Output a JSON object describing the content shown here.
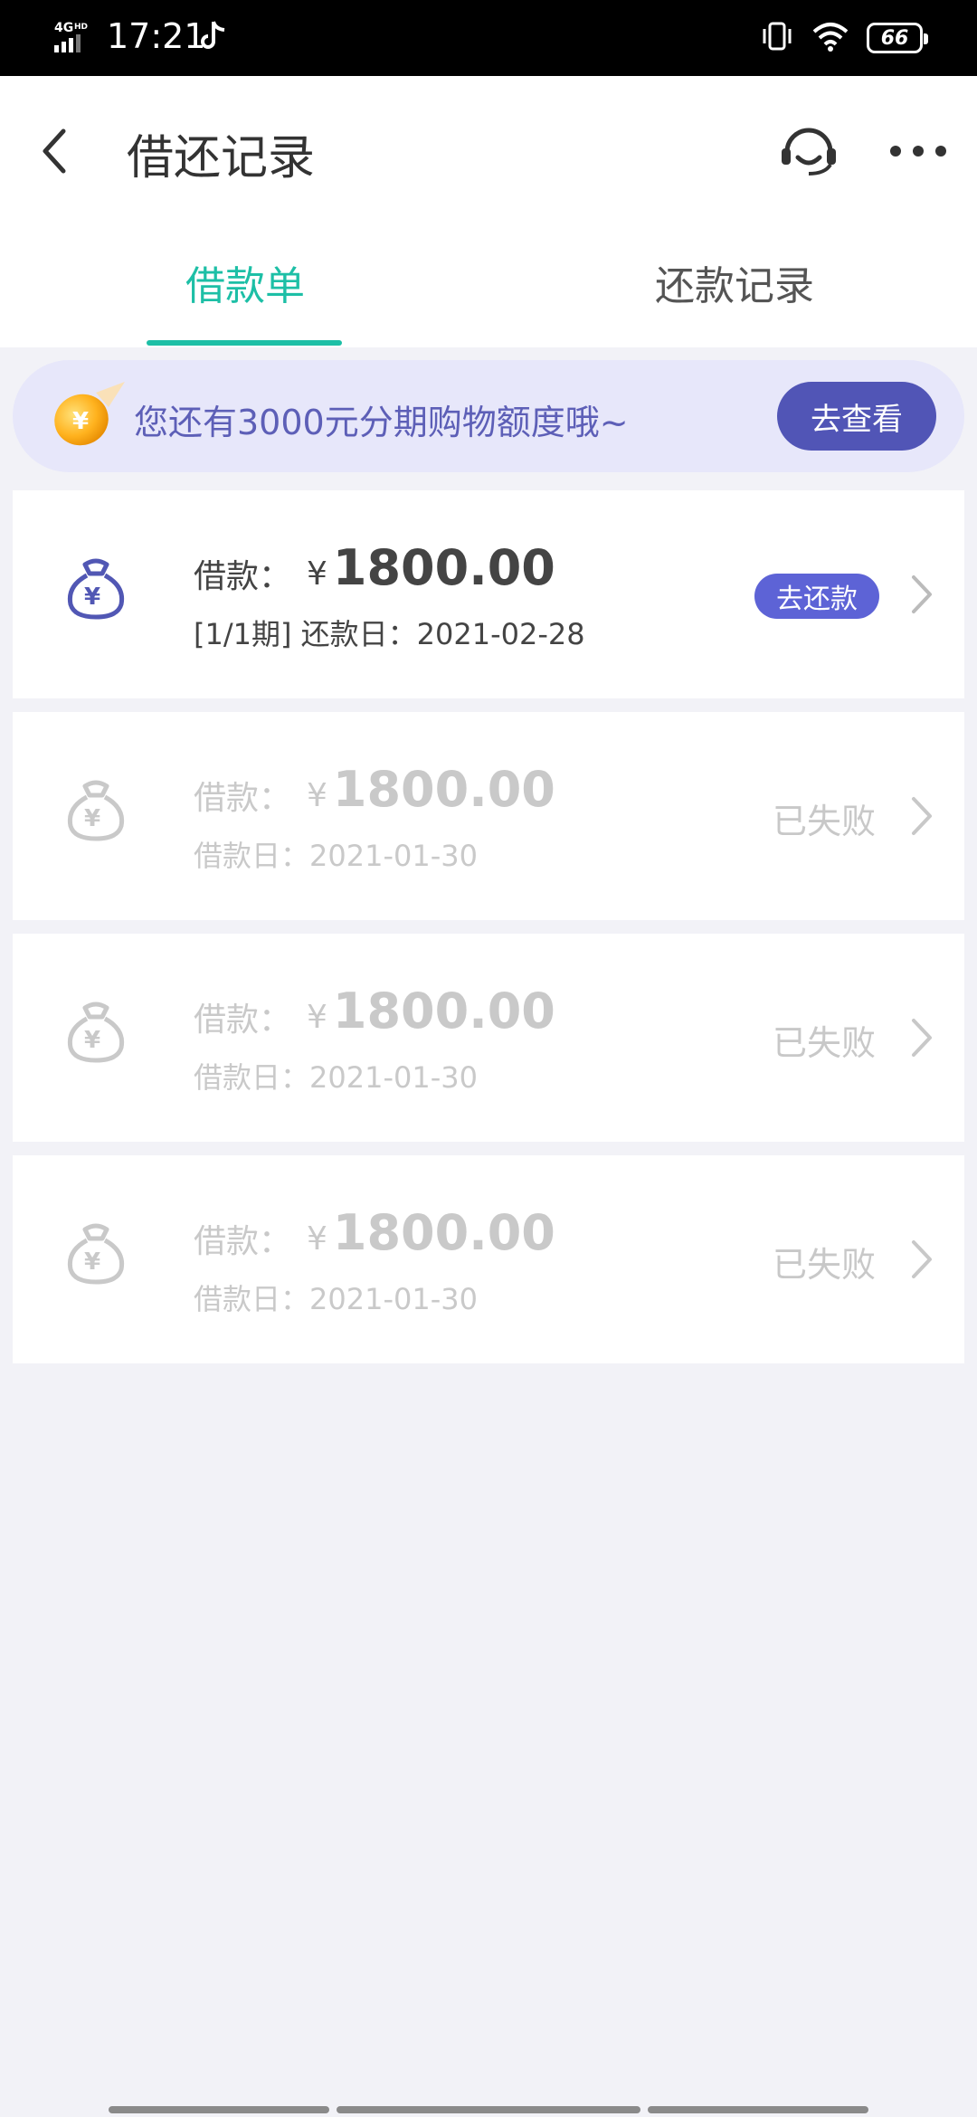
{
  "status_bar": {
    "network": "4G HD",
    "time": "17:21",
    "battery": "66"
  },
  "header": {
    "title": "借还记录",
    "icons": {
      "back": "chevron-left-icon",
      "service": "headset-icon",
      "more": "more-dots-icon"
    }
  },
  "tabs": [
    {
      "label": "借款单",
      "active": true
    },
    {
      "label": "还款记录",
      "active": false
    }
  ],
  "colors": {
    "accent": "#1dbfa6",
    "banner_bg": "#e7e7fa",
    "banner_text": "#5d5fb7",
    "button_purple": "#5155b6",
    "failed_gray": "#c9c9c9"
  },
  "banner": {
    "text": "您还有3000元分期购物额度哦~",
    "button": "去查看"
  },
  "records": [
    {
      "amount_label": "借款：",
      "currency": "¥",
      "amount": "1800.00",
      "sub": "[1/1期] 还款日：2021-02-28",
      "action": "去还款",
      "state": "active"
    },
    {
      "amount_label": "借款：",
      "currency": "¥",
      "amount": "1800.00",
      "sub": "借款日：2021-01-30",
      "status": "已失败",
      "state": "failed"
    },
    {
      "amount_label": "借款：",
      "currency": "¥",
      "amount": "1800.00",
      "sub": "借款日：2021-01-30",
      "status": "已失败",
      "state": "failed"
    },
    {
      "amount_label": "借款：",
      "currency": "¥",
      "amount": "1800.00",
      "sub": "借款日：2021-01-30",
      "status": "已失败",
      "state": "failed"
    }
  ]
}
